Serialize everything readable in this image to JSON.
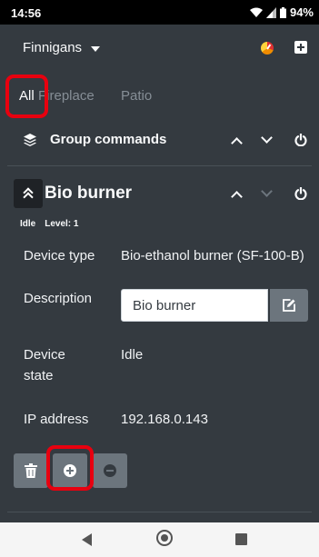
{
  "status_bar": {
    "time": "14:56",
    "battery": "94%"
  },
  "header": {
    "site_name": "Finnigans"
  },
  "tabs": [
    {
      "label": "All",
      "active": true
    },
    {
      "label": "Fireplace",
      "active": false
    },
    {
      "label": "Patio",
      "active": false
    }
  ],
  "group": {
    "label": "Group commands"
  },
  "device": {
    "title": "Bio burner",
    "status": "Idle",
    "level": "Level: 1",
    "rows": {
      "type_label": "Device type",
      "type_value": "Bio-ethanol burner (SF-100-B)",
      "description_label": "Description",
      "description_value": "Bio burner",
      "state_label_1": "Device",
      "state_label_2": "state",
      "state_value": "Idle",
      "ip_label": "IP address",
      "ip_value": "192.168.0.143"
    }
  },
  "colors": {
    "background": "#343a40",
    "highlight": "#e8000f",
    "button": "#6c757d"
  }
}
